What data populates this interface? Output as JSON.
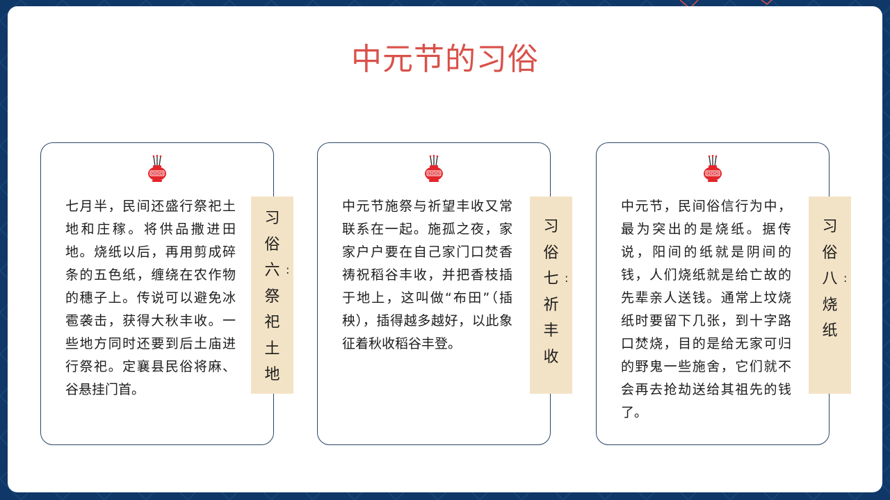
{
  "page": {
    "title": "中元节的习俗"
  },
  "cards": [
    {
      "body": "七月半，民间还盛行祭祀土地和庄稼。将供品撒进田地。烧纸以后，再用剪成碎条的五色纸，缠绕在农作物的穗子上。传说可以避免冰雹袭击，获得大秋丰收。一些地方同时还要到后土庙进行祭祀。定襄县民俗将麻、谷悬挂门首。",
      "label_chars": [
        "习",
        "俗",
        "六",
        "祭",
        "祀",
        "土",
        "地"
      ],
      "label_colon": ":",
      "icon": "incense-burner-icon"
    },
    {
      "body": "中元节施祭与祈望丰收又常联系在一起。施孤之夜，家家户户要在自己家门口焚香祷祝稻谷丰收，并把香枝插于地上，这叫做“布田”（插秧），插得越多越好，以此象征着秋收稻谷丰登。",
      "label_chars": [
        "习",
        "俗",
        "七",
        "祈",
        "丰",
        "收"
      ],
      "label_colon": ":",
      "icon": "incense-burner-icon"
    },
    {
      "body": "中元节，民间俗信行为中，最为突出的是烧纸。据传说，阳间的纸就是阴间的钱，人们烧纸就是给亡故的先辈亲人送钱。通常上坟烧纸时要留下几张，到十字路口焚烧，目的是给无家可归的野鬼一些施舍，它们就不会再去抢劫送给其祖先的钱了。",
      "label_chars": [
        "习",
        "俗",
        "八",
        "烧",
        "纸"
      ],
      "label_colon": ":",
      "icon": "incense-burner-icon"
    }
  ],
  "colors": {
    "background": "#0f3868",
    "title": "#d9514a",
    "card_border": "#2a4466",
    "label_bg": "#f3e3c6",
    "icon_red": "#e3262b"
  }
}
